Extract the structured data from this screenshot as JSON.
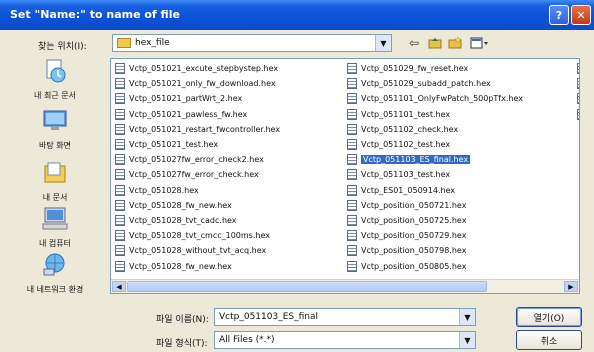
{
  "window": {
    "title": "Set \"Name:\" to name of file"
  },
  "lookin": {
    "label": "찾는 위치(I):",
    "value": "hex_file"
  },
  "places": [
    {
      "label": "내 최근 문서",
      "icon": "recent-documents-icon"
    },
    {
      "label": "바탕 화면",
      "icon": "desktop-icon"
    },
    {
      "label": "내 문서",
      "icon": "my-documents-icon"
    },
    {
      "label": "내 컴퓨터",
      "icon": "my-computer-icon"
    },
    {
      "label": "내 네트워크 환경",
      "icon": "network-places-icon"
    }
  ],
  "files": {
    "col1": [
      "Vctp_051021_excute_stepbystep.hex",
      "Vctp_051021_only_fw_download.hex",
      "Vctp_051021_partWrt_2.hex",
      "Vctp_051021_pawless_fw.hex",
      "Vctp_051021_restart_fwcontroller.hex",
      "Vctp_051021_test.hex",
      "Vctp_051027fw_error_check2.hex",
      "Vctp_051027fw_error_check.hex",
      "Vctp_051028.hex",
      "Vctp_051028_fw_new.hex",
      "Vctp_051028_tvt_cadc.hex",
      "Vctp_051028_tvt_cmcc_100ms.hex",
      "Vctp_051028_without_tvt_acq.hex",
      "Vctp_051028_fw_new.hex"
    ],
    "col2": [
      "Vctp_051029_fw_reset.hex",
      "Vctp_051029_subadd_patch.hex",
      "Vctp_051101_OnlyFwPatch_500pTfx.hex",
      "Vctp_051101_test.hex",
      "Vctp_051102_check.hex",
      "Vctp_051102_test.hex",
      "Vctp_051103_ES_final.hex",
      "Vctp_051103_test.hex",
      "Vctp_ES01_050914.hex",
      "Vctp_position_050721.hex",
      "Vctp_position_050725.hex",
      "Vctp_position_050729.hex",
      "Vctp_position_050798.hex",
      "Vctp_position_050805.hex"
    ],
    "selected_col2_index": 6
  },
  "filename": {
    "label": "파일 이름(N):",
    "value": "Vctp_051103_ES_final"
  },
  "filetype": {
    "label": "파일 형식(T):",
    "value": "All Files (*.*)"
  },
  "buttons": {
    "open": "열기(O)",
    "cancel": "취소"
  },
  "colors": {
    "titlebar": "#0b51d8",
    "selection": "#316ac5"
  }
}
